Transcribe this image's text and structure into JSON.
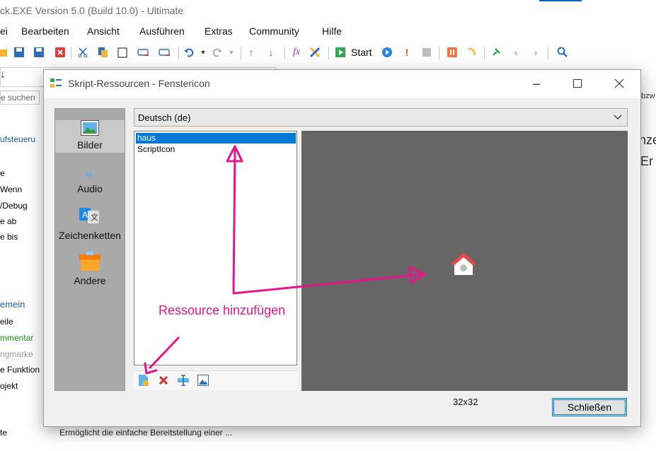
{
  "app": {
    "title": "ck.EXE Version 5.0 (Build 10.0) - Ultimate",
    "menu": [
      "ei",
      "Bearbeiten",
      "Ansicht",
      "Ausführen",
      "Extras",
      "Community",
      "Hilfe"
    ],
    "toolbar": {
      "start_label": "Start",
      "fx_label": "fx"
    },
    "search_placeholder": "e suchen",
    "left_items": [
      "ufsteueru",
      "e",
      "Wenn",
      "/Debug",
      "e ab",
      "e bis",
      "emein",
      "eile",
      "mmentar",
      "ngmarke",
      "e Funktion",
      "ojekt",
      "te"
    ],
    "right_fragments": [
      "bzw",
      "nze",
      "Er"
    ],
    "bottom_desc": "Ermöglicht die einfache Bereitstellung einer ..."
  },
  "dialog": {
    "title": "Skript-Ressourcen - Fenstericon",
    "categories": [
      {
        "label": "Bilder",
        "icon": "image-icon",
        "selected": true
      },
      {
        "label": "Audio",
        "icon": "speaker-icon",
        "selected": false
      },
      {
        "label": "Zeichenketten",
        "icon": "translate-icon",
        "selected": false
      },
      {
        "label": "Andere",
        "icon": "box-icon",
        "selected": false
      }
    ],
    "language": "Deutsch (de)",
    "resources": [
      {
        "name": "haus",
        "selected": true
      },
      {
        "name": "ScriptIcon",
        "selected": false
      }
    ],
    "image_size": "32x32",
    "close_label": "Schließen"
  },
  "annotation": {
    "text": "Ressource hinzufügen",
    "color": "#e6168a"
  },
  "colors": {
    "selection": "#0078d7",
    "preview_bg": "#666666",
    "sidebar_bg": "#a9a9a9"
  }
}
